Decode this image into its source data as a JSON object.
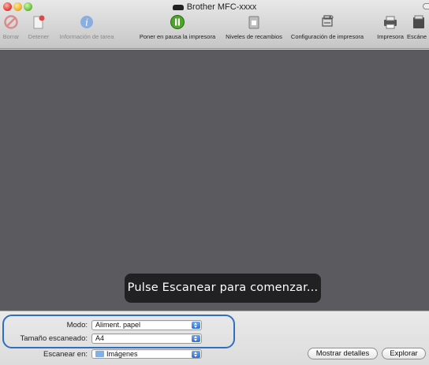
{
  "window": {
    "title": "Brother MFC-xxxx"
  },
  "toolbar": {
    "items": [
      {
        "label": "Borrar",
        "icon": "delete-icon",
        "enabled": false
      },
      {
        "label": "Detener",
        "icon": "stop-document-icon",
        "enabled": false
      },
      {
        "label": "Información de tarea",
        "icon": "info-icon",
        "enabled": false
      },
      {
        "label": "Poner en pausa la impresora",
        "icon": "pause-icon",
        "enabled": true
      },
      {
        "label": "Niveles de recambios",
        "icon": "supply-levels-icon",
        "enabled": true
      },
      {
        "label": "Configuración de impresora",
        "icon": "printer-setup-icon",
        "enabled": true
      },
      {
        "label": "Impresora",
        "icon": "printer-icon",
        "enabled": true
      },
      {
        "label": "Escáne",
        "icon": "scanner-icon",
        "enabled": true
      }
    ]
  },
  "preview": {
    "message": "Pulse Escanear para comenzar..."
  },
  "options": {
    "mode": {
      "label": "Modo:",
      "value": "Aliment. papel"
    },
    "scan_size": {
      "label": "Tamaño escaneado:",
      "value": "A4"
    },
    "scan_to": {
      "label": "Escanear en:",
      "value": "Imágenes"
    }
  },
  "buttons": {
    "show_details": "Mostrar detalles",
    "explore": "Explorar"
  },
  "colors": {
    "preview_bg": "#5b5b5f",
    "highlight": "#2f6fbd",
    "select_accent": "#2f6fd6"
  }
}
